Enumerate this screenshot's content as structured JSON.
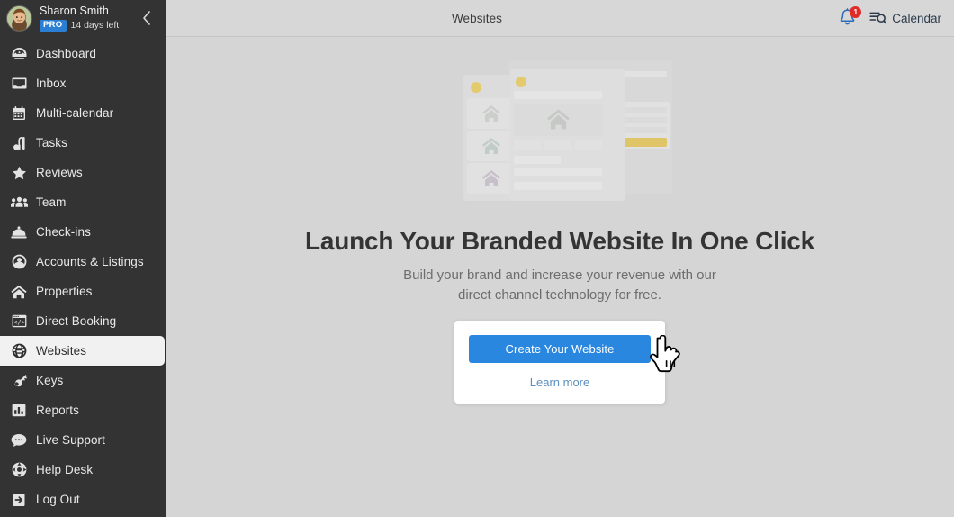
{
  "sidebar": {
    "profile": {
      "name": "Sharon Smith",
      "badge": "PRO",
      "trial": "14 days left",
      "avatar_icon": "user-avatar-photo",
      "collapse_icon": "chevron-left-icon"
    },
    "items": [
      {
        "label": "Dashboard",
        "icon": "speedometer-icon",
        "active": false
      },
      {
        "label": "Inbox",
        "icon": "inbox-tray-icon",
        "active": false
      },
      {
        "label": "Multi-calendar",
        "icon": "calendar-icon",
        "active": false
      },
      {
        "label": "Tasks",
        "icon": "vacuum-icon",
        "active": false
      },
      {
        "label": "Reviews",
        "icon": "star-icon",
        "active": false
      },
      {
        "label": "Team",
        "icon": "people-group-icon",
        "active": false
      },
      {
        "label": "Check-ins",
        "icon": "bell-desk-icon",
        "active": false
      },
      {
        "label": "Accounts & Listings",
        "icon": "user-circle-icon",
        "active": false
      },
      {
        "label": "Properties",
        "icon": "home-icon",
        "active": false
      },
      {
        "label": "Direct Booking",
        "icon": "browser-code-icon",
        "active": false
      },
      {
        "label": "Websites",
        "icon": "globe-icon",
        "active": true
      },
      {
        "label": "Keys",
        "icon": "key-icon",
        "active": false
      },
      {
        "label": "Reports",
        "icon": "bar-chart-icon",
        "active": false
      },
      {
        "label": "Live Support",
        "icon": "chat-bubble-icon",
        "active": false
      },
      {
        "label": "Help Desk",
        "icon": "lifebuoy-icon",
        "active": false
      },
      {
        "label": "Log Out",
        "icon": "logout-arrow-icon",
        "active": false
      }
    ]
  },
  "topbar": {
    "title": "Websites",
    "bell_icon": "notification-bell-icon",
    "notification_count": "1",
    "calendar_icon": "calendar-search-icon",
    "calendar_label": "Calendar"
  },
  "main": {
    "illustration_name": "website-templates-illustration",
    "heading": "Launch Your Branded Website In One Click",
    "subtext_line1": "Build your brand and increase your revenue with our",
    "subtext_line2": "direct channel technology for free.",
    "cta": {
      "button_label": "Create Your Website",
      "link_label": "Learn more",
      "cursor_icon": "pointing-hand-cursor"
    }
  },
  "colors": {
    "sidebar_bg": "#333333",
    "sidebar_active_bg": "#f1f1f1",
    "main_bg": "#d5d5d5",
    "topbar_bg": "#d7d7d7",
    "primary_button": "#2a87e0",
    "link": "#5b8fc0",
    "badge_red": "#e02b28",
    "pro_badge_blue": "#2a7fd4",
    "illustration_yellow": "#f0c419"
  }
}
